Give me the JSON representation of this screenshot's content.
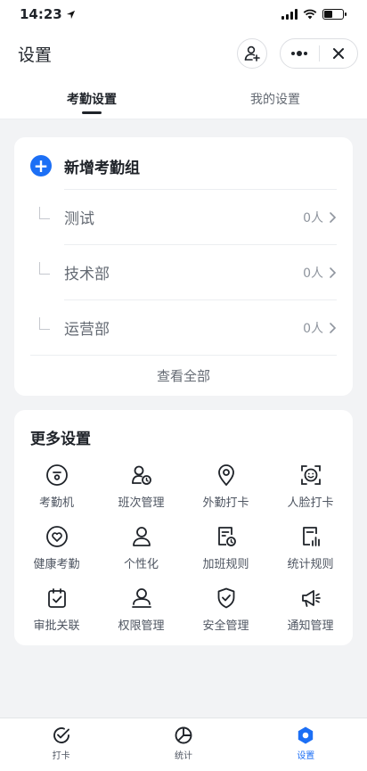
{
  "status": {
    "time": "14:23"
  },
  "nav": {
    "title": "设置"
  },
  "tabs": [
    {
      "label": "考勤设置",
      "active": true
    },
    {
      "label": "我的设置",
      "active": false
    }
  ],
  "groups": {
    "add_label": "新增考勤组",
    "items": [
      {
        "name": "测试",
        "count": "0人"
      },
      {
        "name": "技术部",
        "count": "0人"
      },
      {
        "name": "运营部",
        "count": "0人"
      }
    ],
    "view_all": "查看全部"
  },
  "more": {
    "title": "更多设置",
    "items": [
      {
        "label": "考勤机",
        "icon": "attendance-machine-icon"
      },
      {
        "label": "班次管理",
        "icon": "shift-management-icon"
      },
      {
        "label": "外勤打卡",
        "icon": "location-pin-icon"
      },
      {
        "label": "人脸打卡",
        "icon": "face-scan-icon"
      },
      {
        "label": "健康考勤",
        "icon": "heart-icon"
      },
      {
        "label": "个性化",
        "icon": "person-icon"
      },
      {
        "label": "加班规则",
        "icon": "overtime-rule-icon"
      },
      {
        "label": "统计规则",
        "icon": "stats-rule-icon"
      },
      {
        "label": "审批关联",
        "icon": "approval-icon"
      },
      {
        "label": "权限管理",
        "icon": "permission-icon"
      },
      {
        "label": "安全管理",
        "icon": "shield-icon"
      },
      {
        "label": "通知管理",
        "icon": "megaphone-icon"
      }
    ]
  },
  "bottom_nav": [
    {
      "label": "打卡",
      "icon": "check-in-icon",
      "active": false
    },
    {
      "label": "统计",
      "icon": "statistics-icon",
      "active": false
    },
    {
      "label": "设置",
      "icon": "gear-icon",
      "active": true
    }
  ],
  "colors": {
    "accent": "#1c6ff5",
    "background": "#f2f3f5"
  }
}
